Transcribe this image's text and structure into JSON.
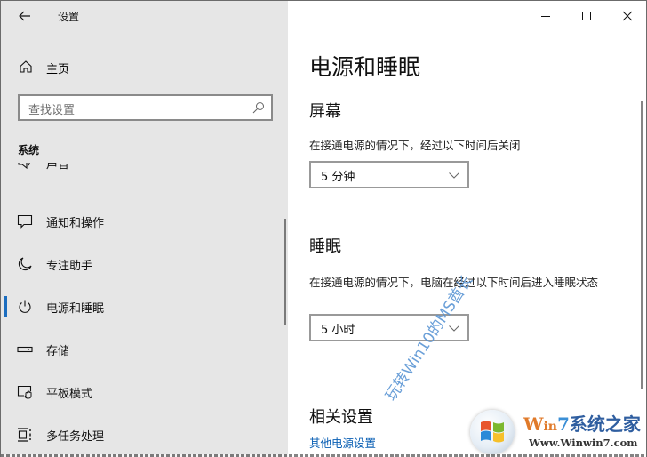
{
  "window": {
    "app_title": "设置",
    "controls": {
      "minimize": "minimize",
      "maximize": "maximize",
      "close": "close"
    }
  },
  "sidebar": {
    "home_label": "主页",
    "search_placeholder": "查找设置",
    "section_label": "系统",
    "items": [
      {
        "label": "声音",
        "icon": "speaker-icon",
        "selected": false
      },
      {
        "label": "通知和操作",
        "icon": "notification-icon",
        "selected": false
      },
      {
        "label": "专注助手",
        "icon": "moon-icon",
        "selected": false
      },
      {
        "label": "电源和睡眠",
        "icon": "power-icon",
        "selected": true
      },
      {
        "label": "存储",
        "icon": "storage-icon",
        "selected": false
      },
      {
        "label": "平板模式",
        "icon": "tablet-mode-icon",
        "selected": false
      },
      {
        "label": "多任务处理",
        "icon": "multitasking-icon",
        "selected": false
      }
    ]
  },
  "main": {
    "page_title": "电源和睡眠",
    "screen": {
      "heading": "屏幕",
      "description": "在接通电源的情况下，经过以下时间后关闭",
      "selected_value": "5 分钟"
    },
    "sleep": {
      "heading": "睡眠",
      "description": "在接通电源的情况下，电脑在经过以下时间后进入睡眠状态",
      "selected_value": "5 小时"
    },
    "related": {
      "heading": "相关设置",
      "link": "其他电源设置"
    }
  },
  "watermarks": {
    "diagonal_text": "玩转Win10的MS酋长",
    "logo_brand_w": "W",
    "logo_brand_in": "in",
    "logo_brand_7": "7",
    "logo_brand_cn": "系统之家",
    "logo_url": "Www.Winwin7.com"
  },
  "colors": {
    "accent": "#1b6dbf",
    "link": "#0a5fb4",
    "sidebar_bg": "#e6e6e6"
  }
}
